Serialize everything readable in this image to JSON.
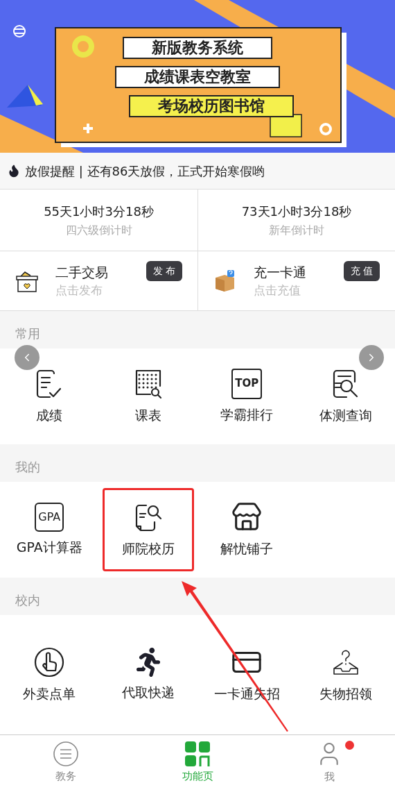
{
  "banner": {
    "lines": [
      {
        "text": "新版教务系统",
        "kind": "white"
      },
      {
        "text": "成绩课表空教室",
        "kind": "white"
      },
      {
        "text": "考场校历图书馆",
        "kind": "yellow"
      }
    ]
  },
  "notice": {
    "text": "放假提醒 | 还有86天放假，正式开始寒假哟"
  },
  "countdowns": [
    {
      "time": "55天1小时3分18秒",
      "label": "四六级倒计时"
    },
    {
      "time": "73天1小时3分18秒",
      "label": "新年倒计时"
    }
  ],
  "services": [
    {
      "kind": "basket",
      "title": "二手交易",
      "subtitle": "点击发布",
      "button": "发 布"
    },
    {
      "kind": "parcel",
      "title": "充一卡通",
      "subtitle": "点击充值",
      "button": "充 值"
    }
  ],
  "sections": [
    {
      "title": "常用",
      "arrows": true,
      "items": [
        {
          "kind": "grades",
          "label": "成绩",
          "highlighted": false
        },
        {
          "kind": "schedule",
          "label": "课表",
          "highlighted": false
        },
        {
          "kind": "top",
          "icon_text": "TOP",
          "label": "学霸排行",
          "highlighted": false
        },
        {
          "kind": "fitness",
          "label": "体测查询",
          "highlighted": false
        }
      ]
    },
    {
      "title": "我的",
      "arrows": false,
      "items": [
        {
          "kind": "gpa",
          "icon_text": "GPA",
          "label": "GPA计算器",
          "highlighted": false
        },
        {
          "kind": "calendar",
          "label": "师院校历",
          "highlighted": true
        },
        {
          "kind": "store",
          "label": "解忧铺子",
          "highlighted": false
        }
      ]
    },
    {
      "title": "校内",
      "arrows": false,
      "items": [
        {
          "kind": "hand",
          "label": "外卖点单",
          "highlighted": false
        },
        {
          "kind": "runner",
          "label": "代取快递",
          "highlighted": false
        },
        {
          "kind": "card",
          "label": "一卡通失招",
          "highlighted": false
        },
        {
          "kind": "lost",
          "label": "失物招领",
          "highlighted": false
        }
      ]
    }
  ],
  "tabbar": [
    {
      "kind": "menu",
      "label": "教务",
      "selected": false,
      "badge": false
    },
    {
      "kind": "apps",
      "label": "功能页",
      "selected": true,
      "badge": false
    },
    {
      "kind": "user",
      "label": "我",
      "selected": false,
      "badge": true
    }
  ]
}
